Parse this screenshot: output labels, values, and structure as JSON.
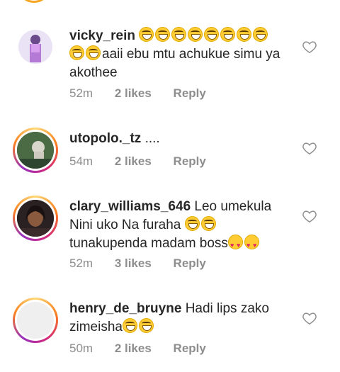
{
  "comments": [
    {
      "username": "vicky_rein",
      "text": "aaii ebu mtu achukue simu ya akothee",
      "time": "52m",
      "likes": "2 likes",
      "reply": "Reply"
    },
    {
      "username": "utopolo._tz",
      "text": "....",
      "time": "54m",
      "likes": "2 likes",
      "reply": "Reply"
    },
    {
      "username": "clary_williams_646",
      "text": "Leo umekula Nini uko Na furaha",
      "text2": "tunakupenda madam boss",
      "time": "52m",
      "likes": "3 likes",
      "reply": "Reply"
    },
    {
      "username": "henry_de_bruyne",
      "text": "Hadi lips zako zimeisha",
      "time": "50m",
      "likes": "2 likes",
      "reply": "Reply"
    }
  ],
  "icons": {
    "like": "heart-outline-icon",
    "emoji_laugh": "tears-of-joy-emoji",
    "emoji_love": "heart-eyes-emoji"
  },
  "colors": {
    "username": "#262626",
    "meta": "#8e8e8e",
    "story_ring_start": "#feda75",
    "story_ring_end": "#962fbf"
  }
}
